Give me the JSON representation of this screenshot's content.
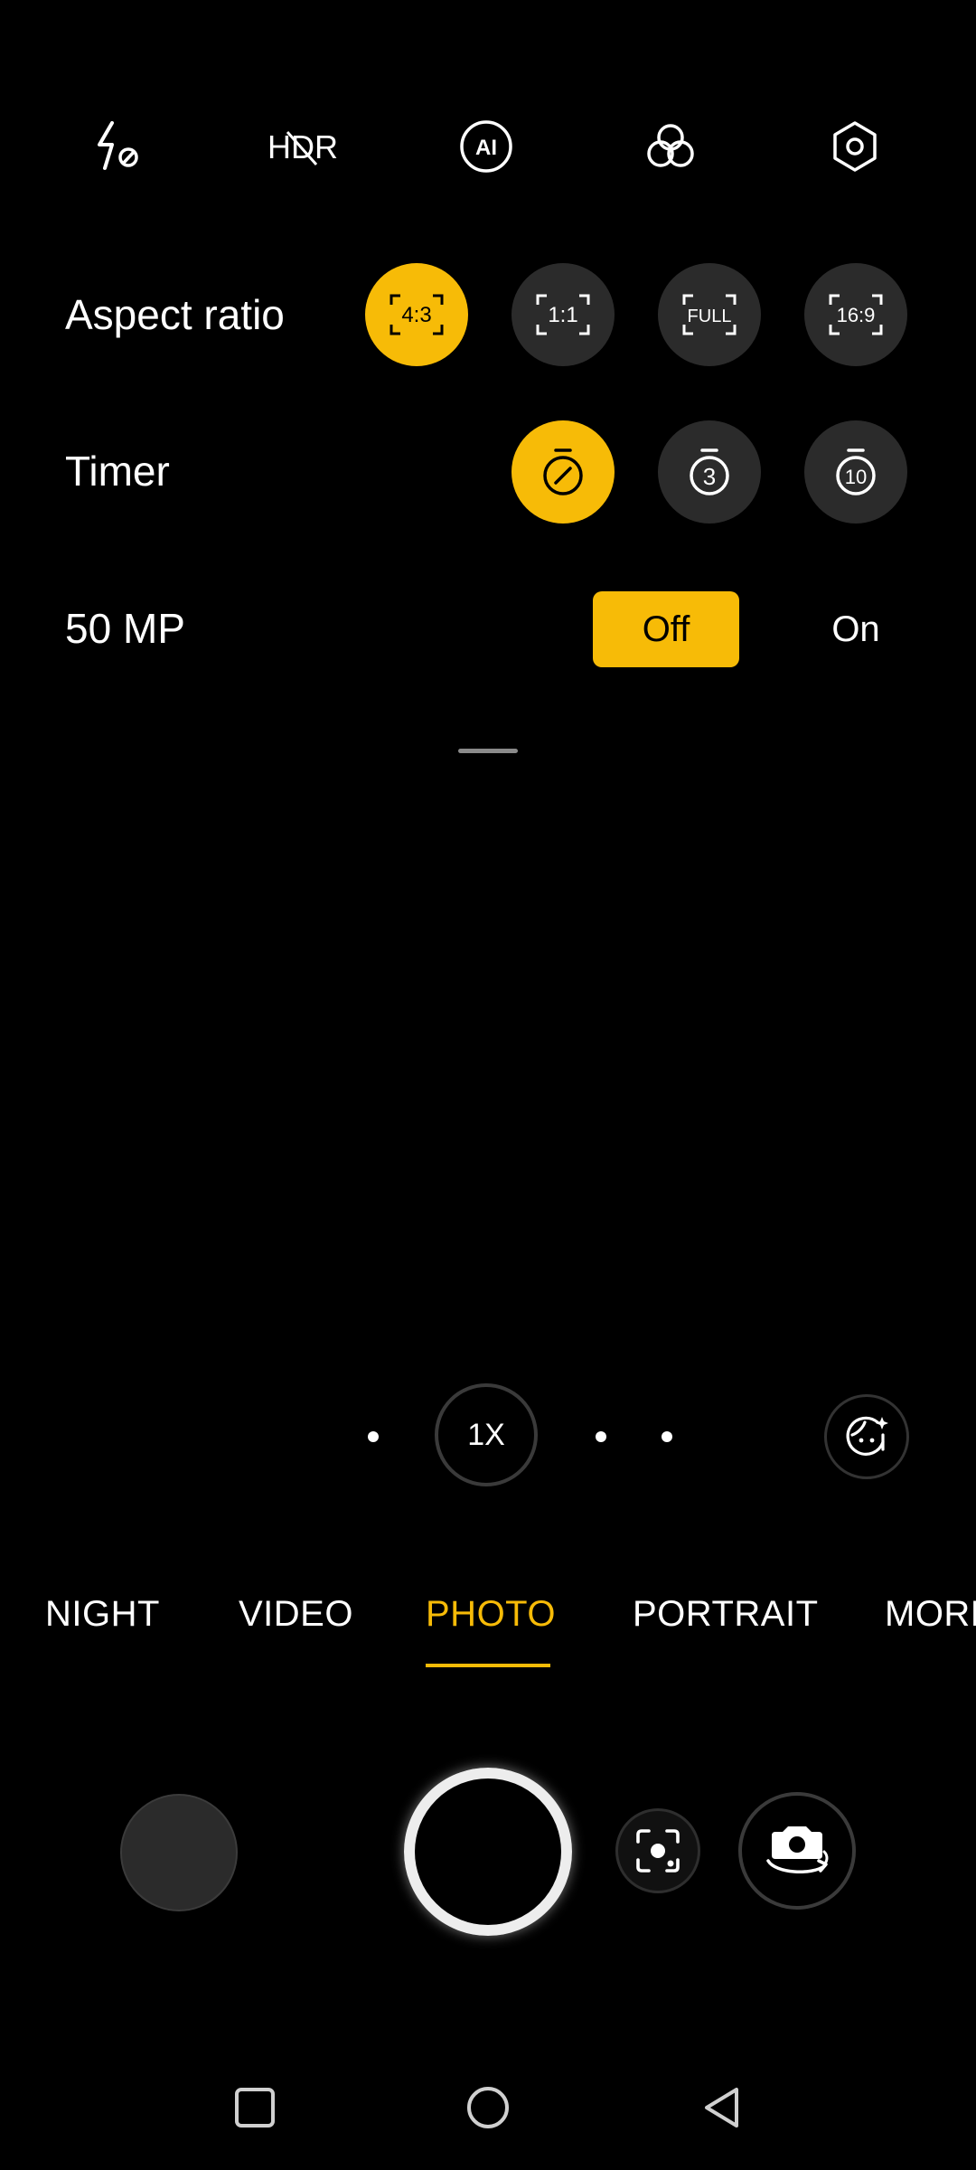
{
  "top_bar": {
    "flash": "flash-off-icon",
    "hdr": {
      "icon": "hdr-off-icon",
      "label": "HDR"
    },
    "ai": {
      "icon": "ai-icon",
      "label": "AI"
    },
    "filters": "filters-icon",
    "settings": "settings-icon"
  },
  "aspect_ratio": {
    "label": "Aspect ratio",
    "options": [
      "4:3",
      "1:1",
      "FULL",
      "16:9"
    ],
    "selected": "4:3"
  },
  "timer": {
    "label": "Timer",
    "options": [
      "timer-off-icon",
      "timer-3s-icon",
      "timer-10s-icon"
    ],
    "option_labels": [
      "",
      "3",
      "10"
    ],
    "selected": "off"
  },
  "megapixel": {
    "label": "50 MP",
    "off_label": "Off",
    "on_label": "On",
    "selected": "Off"
  },
  "zoom": {
    "label": "1X"
  },
  "modes": {
    "items": [
      "NIGHT",
      "VIDEO",
      "PHOTO",
      "PORTRAIT",
      "MORE"
    ],
    "selected": "PHOTO"
  },
  "colors": {
    "accent": "#f7bb07",
    "background": "#000000",
    "button_bg": "#2b2b2b"
  },
  "nav": {
    "recents": "square-icon",
    "home": "circle-icon",
    "back": "triangle-back-icon"
  }
}
